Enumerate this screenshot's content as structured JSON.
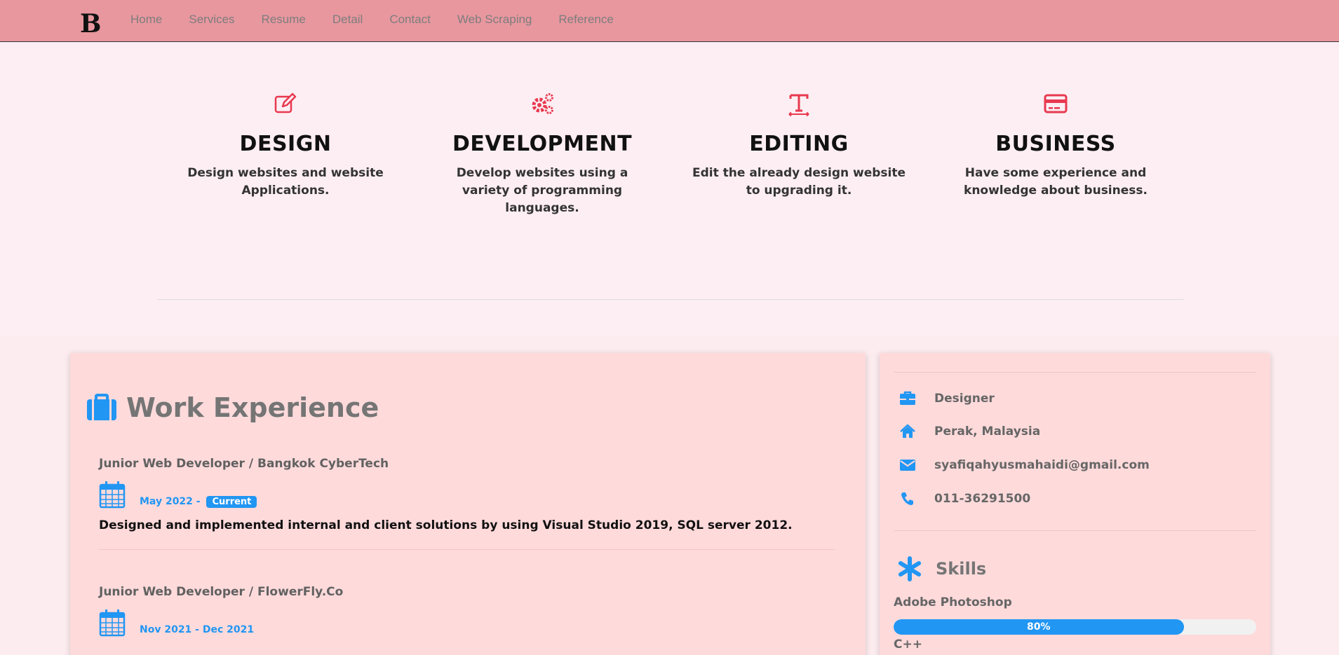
{
  "nav": {
    "logo_text": "B",
    "links": [
      "Home",
      "Services",
      "Resume",
      "Detail",
      "Contact",
      "Web Scraping",
      "Reference"
    ]
  },
  "services": [
    {
      "icon": "edit-icon",
      "title": "DESIGN",
      "desc": "Design websites and website Applications."
    },
    {
      "icon": "gears-icon",
      "title": "DEVELOPMENT",
      "desc": "Develop websites using a variety of programming languages."
    },
    {
      "icon": "text-size-icon",
      "title": "EDITING",
      "desc": "Edit the already design website to upgrading it."
    },
    {
      "icon": "credit-card-icon",
      "title": "BUSINESS",
      "desc": "Have some experience and knowledge about business."
    }
  ],
  "work": {
    "title": "Work Experience",
    "jobs": [
      {
        "title": "Junior Web Developer / Bangkok CyberTech",
        "date": "May 2022 -",
        "tag": "Current",
        "desc": "Designed and implemented internal and client solutions by using Visual Studio 2019, SQL server 2012."
      },
      {
        "title": "Junior Web Developer / FlowerFly.Co",
        "date": "Nov 2021 - Dec 2021",
        "tag": "",
        "desc": ""
      }
    ]
  },
  "profile": {
    "job": "Designer",
    "location": "Perak, Malaysia",
    "email": "syafiqahyusmahaidi@gmail.com",
    "phone": "011-36291500"
  },
  "skills": {
    "title": "Skills",
    "items": [
      {
        "name": "Adobe Photoshop",
        "percent": 80,
        "label": "80%"
      },
      {
        "name": "C++"
      }
    ]
  },
  "colors": {
    "accent": "#2196f3",
    "nav_bg": "#e8979f",
    "icon_red": "#e8394f",
    "card_bg": "#ffdadb"
  }
}
